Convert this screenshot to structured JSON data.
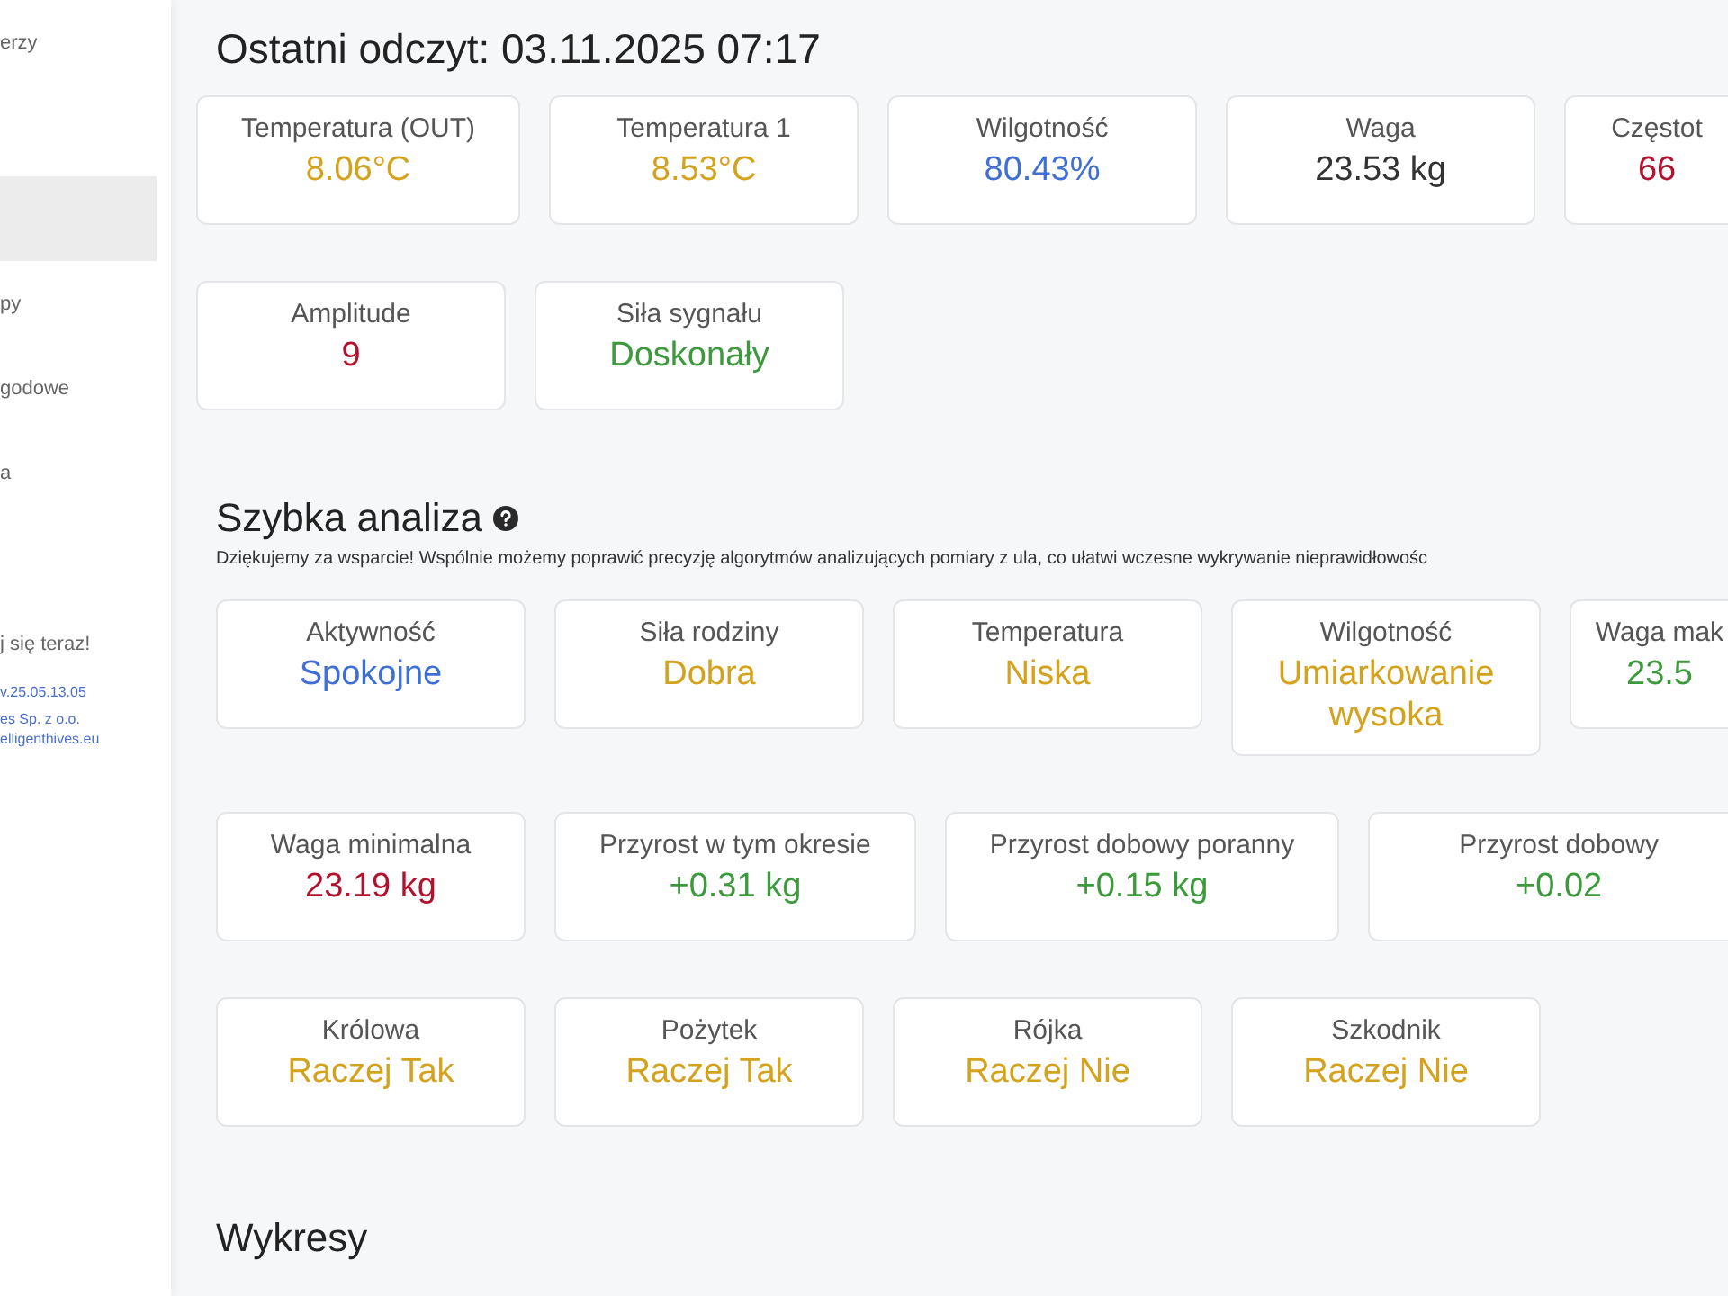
{
  "sidebar": {
    "items": [
      {
        "label": "erzy",
        "selected": false
      },
      {
        "selected": true
      },
      {
        "label": "py",
        "selected": false
      },
      {
        "label": "godowe",
        "selected": false
      },
      {
        "label": "a",
        "selected": false
      }
    ],
    "footer": {
      "cta": "j się teraz!",
      "version": "v.25.05.13.05",
      "company": "es Sp. z o.o.",
      "website": "elligenthives.eu"
    }
  },
  "last_reading": {
    "title": "Ostatni odczyt: 03.11.2025 07:17",
    "rows": [
      [
        {
          "label": "Temperatura (OUT)",
          "value": "8.06°C",
          "color": "#d4a21c"
        },
        {
          "label": "Temperatura 1",
          "value": "8.53°C",
          "color": "#d4a21c"
        },
        {
          "label": "Wilgotność",
          "value": "80.43%",
          "color": "#3e6fd6"
        },
        {
          "label": "Waga",
          "value": "23.53 kg",
          "color": "#333333"
        },
        {
          "label": "Częstot",
          "value": "66",
          "color": "#b3122e"
        }
      ],
      [
        {
          "label": "Amplitude",
          "value": "9",
          "color": "#b3122e"
        },
        {
          "label": "Siła sygnału",
          "value": "Doskonały",
          "color": "#3c9a3c"
        }
      ]
    ]
  },
  "quick_analysis": {
    "title": "Szybka analiza",
    "note": "Dziękujemy za wsparcie! Wspólnie możemy poprawić precyzję algorytmów analizujących pomiary z ula, co ułatwi wczesne wykrywanie nieprawidłowośc",
    "rows": [
      [
        {
          "label": "Aktywność",
          "value": "Spokojne",
          "color": "#3e6fd6"
        },
        {
          "label": "Siła rodziny",
          "value": "Dobra",
          "color": "#d4a21c"
        },
        {
          "label": "Temperatura",
          "value": "Niska",
          "color": "#d4a21c"
        },
        {
          "label": "Wilgotność",
          "value": "Umiarkowanie wysoka",
          "color": "#d4a21c"
        },
        {
          "label": "Waga mak",
          "value": "23.5",
          "color": "#3c9a3c"
        }
      ],
      [
        {
          "label": "Waga minimalna",
          "value": "23.19 kg",
          "color": "#b3122e"
        },
        {
          "label": "Przyrost w tym okresie",
          "value": "+0.31 kg",
          "color": "#3c9a3c"
        },
        {
          "label": "Przyrost dobowy poranny",
          "value": "+0.15 kg",
          "color": "#3c9a3c"
        },
        {
          "label": "Przyrost dobowy",
          "value": "+0.02",
          "color": "#3c9a3c"
        }
      ],
      [
        {
          "label": "Królowa",
          "value": "Raczej Tak",
          "color": "#d4a21c"
        },
        {
          "label": "Pożytek",
          "value": "Raczej Tak",
          "color": "#d4a21c"
        },
        {
          "label": "Rójka",
          "value": "Raczej Nie",
          "color": "#d4a21c"
        },
        {
          "label": "Szkodnik",
          "value": "Raczej Nie",
          "color": "#d4a21c"
        }
      ]
    ]
  },
  "charts_section": {
    "title": "Wykresy"
  }
}
